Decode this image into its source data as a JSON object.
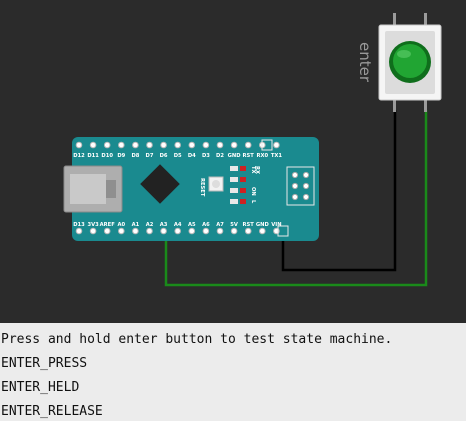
{
  "colors": {
    "board": "#1a8a8f",
    "wire_black": "#000000",
    "wire_green": "#1a8a1a",
    "button_cap": "#21a533",
    "canvas": "#2b2b2b",
    "console_bg": "#ececec"
  },
  "board": {
    "top_pins": [
      "D12",
      "D11",
      "D10",
      "D9",
      "D8",
      "D7",
      "D6",
      "D5",
      "D4",
      "D3",
      "D2",
      "GND",
      "RST",
      "RX0",
      "TX1"
    ],
    "bottom_pins": [
      "D13",
      "3V3",
      "AREF",
      "A0",
      "A1",
      "A2",
      "A3",
      "A4",
      "A5",
      "A6",
      "A7",
      "5V",
      "RST",
      "GND",
      "VIN"
    ],
    "leds": [
      "TX",
      "RX",
      "ON",
      "L"
    ],
    "reset_label": "RESET"
  },
  "pushbutton": {
    "label": "enter"
  },
  "console": {
    "lines": [
      "Press and hold enter button to test state machine.",
      "ENTER_PRESS",
      "ENTER_HELD",
      "ENTER_RELEASE"
    ]
  }
}
